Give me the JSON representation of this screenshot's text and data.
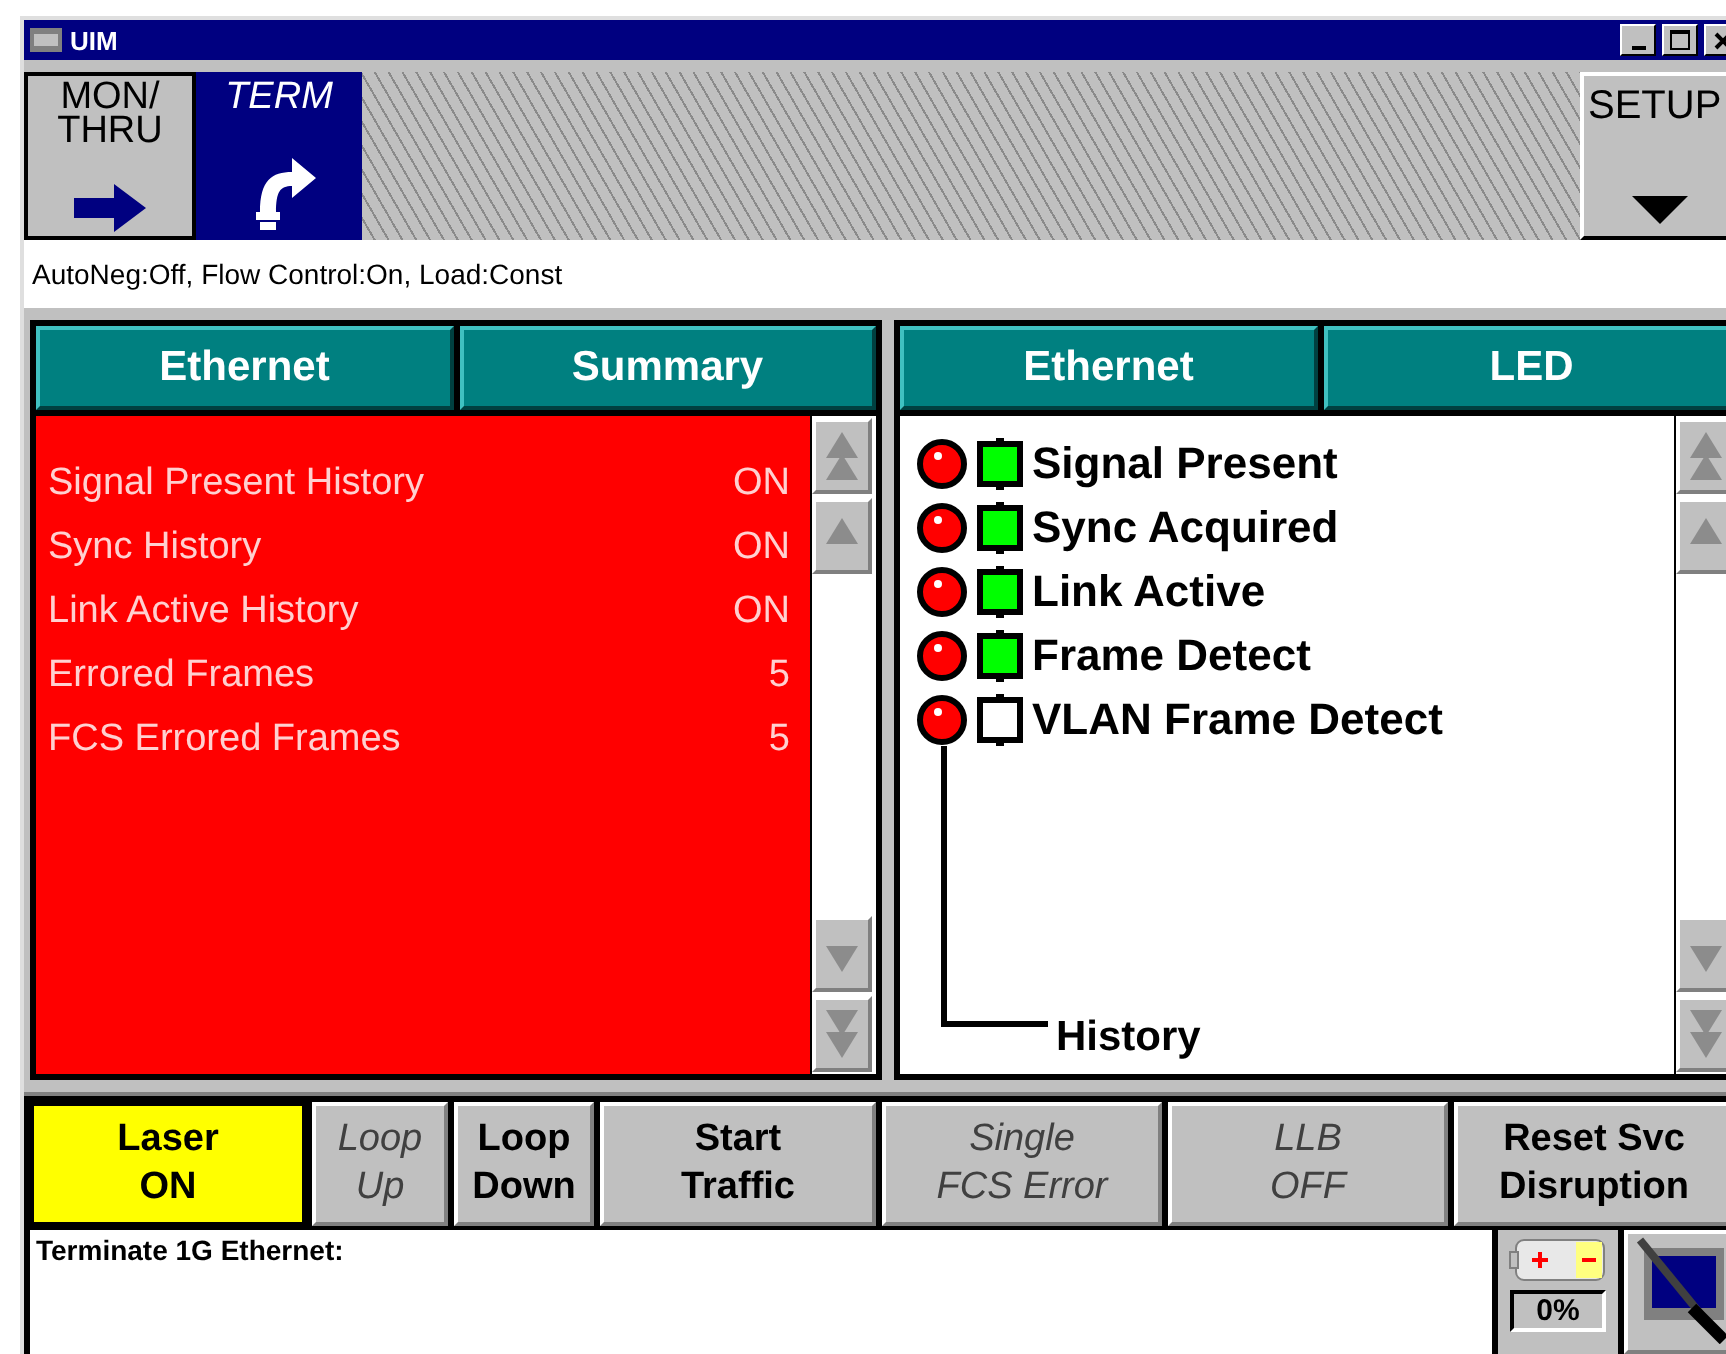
{
  "window": {
    "title": "UIM"
  },
  "mode_buttons": [
    {
      "kind": "mon",
      "lines": [
        "MON/",
        "THRU"
      ],
      "selected": false
    },
    {
      "kind": "term",
      "lines": [
        "TERM"
      ],
      "selected": true
    }
  ],
  "setup_button": {
    "label": "SETUP"
  },
  "status_line": "AutoNeg:Off, Flow Control:On, Load:Const",
  "summary_panel": {
    "headers": [
      "Ethernet",
      "Summary"
    ],
    "rows": [
      {
        "label": "Signal Present History",
        "value": "ON"
      },
      {
        "label": "Sync History",
        "value": "ON"
      },
      {
        "label": "Link Active History",
        "value": "ON"
      },
      {
        "label": "Errored Frames",
        "value": "5"
      },
      {
        "label": "FCS Errored Frames",
        "value": "5"
      }
    ]
  },
  "led_panel": {
    "headers": [
      "Ethernet",
      "LED"
    ],
    "leds": [
      {
        "label": "Signal Present",
        "history": true,
        "current": true
      },
      {
        "label": "Sync Acquired",
        "history": true,
        "current": true
      },
      {
        "label": "Link Active",
        "history": true,
        "current": true
      },
      {
        "label": "Frame Detect",
        "history": true,
        "current": true
      },
      {
        "label": "VLAN Frame Detect",
        "history": true,
        "current": false
      }
    ],
    "history_label": "History"
  },
  "action_buttons": [
    {
      "lines": [
        "Laser",
        "ON"
      ],
      "on": true,
      "disabled": false
    },
    {
      "lines": [
        "Loop",
        "Up"
      ],
      "on": false,
      "disabled": true
    },
    {
      "lines": [
        "Loop",
        "Down"
      ],
      "on": false,
      "disabled": false
    },
    {
      "lines": [
        "Start",
        "Traffic"
      ],
      "on": false,
      "disabled": false
    },
    {
      "lines": [
        "Single",
        "FCS Error"
      ],
      "on": false,
      "disabled": true
    },
    {
      "lines": [
        "LLB",
        "OFF"
      ],
      "on": false,
      "disabled": true
    },
    {
      "lines": [
        "Reset Svc",
        "Disruption"
      ],
      "on": false,
      "disabled": false
    }
  ],
  "message": "Terminate 1G Ethernet:",
  "battery": {
    "reading": "0%"
  }
}
